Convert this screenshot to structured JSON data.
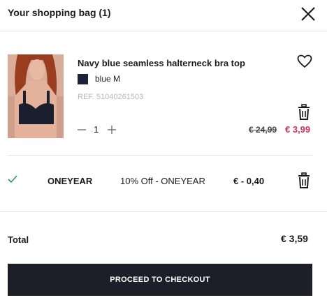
{
  "header": {
    "title": "Your shopping bag (1)"
  },
  "item": {
    "name": "Navy blue seamless halterneck bra top",
    "swatch_color": "#1e2437",
    "variant": "blue M",
    "ref": "REF. 51040261503",
    "quantity": "1",
    "old_price": "€ 24,99",
    "new_price": "€ 3,99",
    "sale_color": "#d2335a"
  },
  "discount": {
    "code": "ONEYEAR",
    "description": "10% Off - ONEYEAR",
    "amount": "€ - 0,40"
  },
  "summary": {
    "total_label": "Total",
    "total_value": "€ 3,59"
  },
  "checkout": {
    "label": "PROCEED TO CHECKOUT"
  },
  "icons": [
    "close-icon",
    "heart-icon",
    "trash-icon",
    "minus-icon",
    "plus-icon",
    "check-icon"
  ]
}
